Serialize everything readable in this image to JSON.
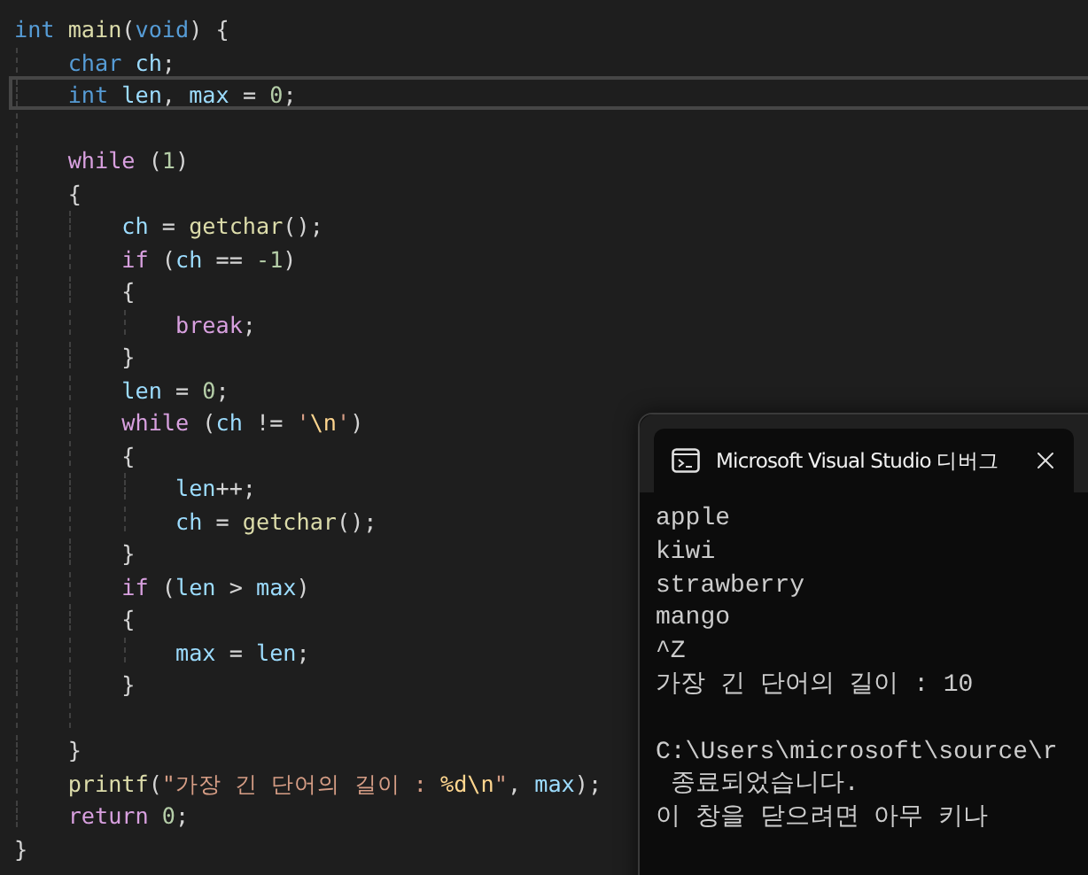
{
  "editor": {
    "lines": [
      {
        "current": false,
        "tokens": [
          {
            "kind": "kw",
            "text": "int"
          },
          {
            "kind": "fn",
            "text": " main"
          },
          {
            "kind": "op",
            "text": "("
          },
          {
            "kind": "kw",
            "text": "void"
          },
          {
            "kind": "op",
            "text": ") {"
          }
        ]
      },
      {
        "current": false,
        "tokens": [
          {
            "kind": "kw",
            "text": "    char"
          },
          {
            "kind": "var",
            "text": " ch"
          },
          {
            "kind": "op",
            "text": ";"
          }
        ]
      },
      {
        "current": true,
        "tokens": [
          {
            "kind": "kw",
            "text": "    int"
          },
          {
            "kind": "var",
            "text": " len"
          },
          {
            "kind": "op",
            "text": ","
          },
          {
            "kind": "var",
            "text": " max"
          },
          {
            "kind": "op",
            "text": " ="
          },
          {
            "kind": "num",
            "text": " 0"
          },
          {
            "kind": "op",
            "text": ";"
          }
        ]
      },
      {
        "current": false
      },
      {
        "current": false,
        "tokens": [
          {
            "kind": "ctl",
            "text": "    while"
          },
          {
            "kind": "op",
            "text": " ("
          },
          {
            "kind": "num",
            "text": "1"
          },
          {
            "kind": "op",
            "text": ")"
          }
        ]
      },
      {
        "current": false,
        "tokens": [
          {
            "kind": "op",
            "text": "    {"
          }
        ]
      },
      {
        "current": false,
        "tokens": [
          {
            "kind": "var",
            "text": "        ch"
          },
          {
            "kind": "op",
            "text": " ="
          },
          {
            "kind": "fn",
            "text": " getchar"
          },
          {
            "kind": "op",
            "text": "();"
          }
        ]
      },
      {
        "current": false,
        "tokens": [
          {
            "kind": "ctl",
            "text": "        if"
          },
          {
            "kind": "op",
            "text": " ("
          },
          {
            "kind": "var",
            "text": "ch"
          },
          {
            "kind": "op",
            "text": " =="
          },
          {
            "kind": "num",
            "text": " -1"
          },
          {
            "kind": "op",
            "text": ")"
          }
        ]
      },
      {
        "current": false,
        "tokens": [
          {
            "kind": "op",
            "text": "        {"
          }
        ]
      },
      {
        "current": false,
        "tokens": [
          {
            "kind": "ctl",
            "text": "            break"
          },
          {
            "kind": "op",
            "text": ";"
          }
        ]
      },
      {
        "current": false,
        "tokens": [
          {
            "kind": "op",
            "text": "        }"
          }
        ]
      },
      {
        "current": false,
        "tokens": [
          {
            "kind": "var",
            "text": "        len"
          },
          {
            "kind": "op",
            "text": " ="
          },
          {
            "kind": "num",
            "text": " 0"
          },
          {
            "kind": "op",
            "text": ";"
          }
        ]
      },
      {
        "current": false,
        "tokens": [
          {
            "kind": "ctl",
            "text": "        while"
          },
          {
            "kind": "op",
            "text": " ("
          },
          {
            "kind": "var",
            "text": "ch"
          },
          {
            "kind": "op",
            "text": " !="
          },
          {
            "kind": "str",
            "text": " '"
          },
          {
            "kind": "esc",
            "text": "\\n"
          },
          {
            "kind": "str",
            "text": "'"
          },
          {
            "kind": "op",
            "text": ")"
          }
        ]
      },
      {
        "current": false,
        "tokens": [
          {
            "kind": "op",
            "text": "        {"
          }
        ]
      },
      {
        "current": false,
        "tokens": [
          {
            "kind": "var",
            "text": "            len"
          },
          {
            "kind": "op",
            "text": "++;"
          }
        ]
      },
      {
        "current": false,
        "tokens": [
          {
            "kind": "var",
            "text": "            ch"
          },
          {
            "kind": "op",
            "text": " ="
          },
          {
            "kind": "fn",
            "text": " getchar"
          },
          {
            "kind": "op",
            "text": "();"
          }
        ]
      },
      {
        "current": false,
        "tokens": [
          {
            "kind": "op",
            "text": "        }"
          }
        ]
      },
      {
        "current": false,
        "tokens": [
          {
            "kind": "ctl",
            "text": "        if"
          },
          {
            "kind": "op",
            "text": " ("
          },
          {
            "kind": "var",
            "text": "len"
          },
          {
            "kind": "op",
            "text": " >"
          },
          {
            "kind": "var",
            "text": " max"
          },
          {
            "kind": "op",
            "text": ")"
          }
        ]
      },
      {
        "current": false,
        "tokens": [
          {
            "kind": "op",
            "text": "        {"
          }
        ]
      },
      {
        "current": false,
        "tokens": [
          {
            "kind": "var",
            "text": "            max"
          },
          {
            "kind": "op",
            "text": " ="
          },
          {
            "kind": "var",
            "text": " len"
          },
          {
            "kind": "op",
            "text": ";"
          }
        ]
      },
      {
        "current": false,
        "tokens": [
          {
            "kind": "op",
            "text": "        }"
          }
        ]
      },
      {
        "current": false
      },
      {
        "current": false,
        "tokens": [
          {
            "kind": "op",
            "text": "    }"
          }
        ]
      },
      {
        "current": false,
        "tokens": [
          {
            "kind": "fn",
            "text": "    printf"
          },
          {
            "kind": "op",
            "text": "("
          },
          {
            "kind": "str",
            "text": "\"가장 긴 단어의 길이 : "
          },
          {
            "kind": "esc",
            "text": "%d\\n"
          },
          {
            "kind": "str",
            "text": "\""
          },
          {
            "kind": "op",
            "text": ","
          },
          {
            "kind": "var",
            "text": " max"
          },
          {
            "kind": "op",
            "text": ");"
          }
        ]
      },
      {
        "current": false,
        "tokens": [
          {
            "kind": "ctl",
            "text": "    return"
          },
          {
            "kind": "num",
            "text": " 0"
          },
          {
            "kind": "op",
            "text": ";"
          }
        ]
      },
      {
        "current": false,
        "tokens": [
          {
            "kind": "op",
            "text": "}"
          }
        ]
      }
    ]
  },
  "console": {
    "tab_title": "Microsoft Visual Studio 디버그",
    "output": [
      "apple",
      "kiwi",
      "strawberry",
      "mango",
      "^Z",
      "가장 긴 단어의 길이 : 10"
    ],
    "messages": [
      "C:\\Users\\microsoft\\source\\r",
      " 종료되었습니다.",
      "이 창을 닫으려면 아무 키나"
    ]
  }
}
